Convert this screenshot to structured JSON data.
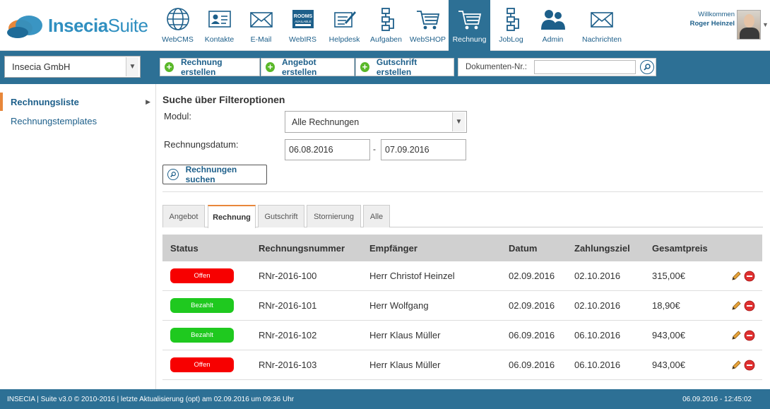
{
  "brand": {
    "name_bold": "Insecia",
    "name_light": "Suite"
  },
  "nav": [
    {
      "id": "webcms",
      "label": "WebCMS",
      "icon": "globe-icon"
    },
    {
      "id": "kontakte",
      "label": "Kontakte",
      "icon": "contact-card-icon"
    },
    {
      "id": "email",
      "label": "E-Mail",
      "icon": "envelope-icon"
    },
    {
      "id": "webirs",
      "label": "WebIRS",
      "icon": "rooms-available-icon"
    },
    {
      "id": "helpdesk",
      "label": "Helpdesk",
      "icon": "notepad-pen-icon"
    },
    {
      "id": "aufgaben",
      "label": "Aufgaben",
      "icon": "hierarchy-icon"
    },
    {
      "id": "webshop",
      "label": "WebSHOP",
      "icon": "shopping-cart-icon"
    },
    {
      "id": "rechnung",
      "label": "Rechnung",
      "icon": "shopping-cart-icon"
    },
    {
      "id": "joblog",
      "label": "JobLog",
      "icon": "hierarchy-icon"
    },
    {
      "id": "admin",
      "label": "Admin",
      "icon": "users-icon"
    },
    {
      "id": "nachrichten",
      "label": "Nachrichten",
      "icon": "envelope-icon"
    }
  ],
  "nav_rooms_text": "ROOMS",
  "nav_rooms_sub": "AVAILABLE",
  "user": {
    "greeting": "Willkommen",
    "name": "Roger Heinzel"
  },
  "toolbar": {
    "company": "Insecia GmbH",
    "btn_rechnung": "Rechnung erstellen",
    "btn_angebot": "Angebot erstellen",
    "btn_gutschrift": "Gutschrift erstellen",
    "doc_label": "Dokumenten-Nr.:",
    "doc_value": ""
  },
  "sidebar": {
    "items": [
      {
        "label": "Rechnungsliste",
        "active": true
      },
      {
        "label": "Rechnungstemplates",
        "active": false
      }
    ]
  },
  "filter": {
    "title": "Suche über Filteroptionen",
    "modul_label": "Modul:",
    "modul_value": "Alle Rechnungen",
    "date_label": "Rechnungsdatum:",
    "date_from": "06.08.2016",
    "date_sep": "-",
    "date_to": "07.09.2016",
    "search_button": "Rechnungen suchen"
  },
  "tabs": [
    {
      "label": "Angebot",
      "active": false
    },
    {
      "label": "Rechnung",
      "active": true
    },
    {
      "label": "Gutschrift",
      "active": false
    },
    {
      "label": "Stornierung",
      "active": false
    },
    {
      "label": "Alle",
      "active": false
    }
  ],
  "table": {
    "headers": {
      "status": "Status",
      "number": "Rechnungsnummer",
      "recipient": "Empfänger",
      "date": "Datum",
      "due": "Zahlungsziel",
      "total": "Gesamtpreis"
    },
    "rows": [
      {
        "status": "Offen",
        "status_color": "#f70000",
        "number": "RNr-2016-100",
        "recipient": "Herr Christof Heinzel",
        "date": "02.09.2016",
        "due": "02.10.2016",
        "total": "315,00€"
      },
      {
        "status": "Bezahlt",
        "status_color": "#1fc91f",
        "number": "RNr-2016-101",
        "recipient": "Herr Wolfgang",
        "date": "02.09.2016",
        "due": "02.10.2016",
        "total": "18,90€"
      },
      {
        "status": "Bezahlt",
        "status_color": "#1fc91f",
        "number": "RNr-2016-102",
        "recipient": "Herr Klaus Müller",
        "date": "06.09.2016",
        "due": "06.10.2016",
        "total": "943,00€"
      },
      {
        "status": "Offen",
        "status_color": "#f70000",
        "number": "RNr-2016-103",
        "recipient": "Herr Klaus Müller",
        "date": "06.09.2016",
        "due": "06.10.2016",
        "total": "943,00€"
      }
    ]
  },
  "footer": {
    "left": "INSECIA | Suite v3.0 © 2010-2016 | letzte Aktualisierung (opt) am 02.09.2016 um 09:36 Uhr",
    "right": "06.09.2016 - 12:45:02"
  },
  "colors": {
    "primary": "#2d7095",
    "accent": "#e8873a",
    "link": "#1d5f8a",
    "open": "#f70000",
    "paid": "#1fc91f"
  }
}
